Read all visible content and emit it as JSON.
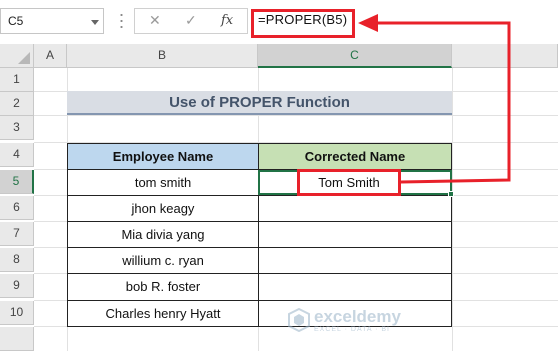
{
  "formula_bar": {
    "name_box": "C5",
    "cancel_glyph": "✕",
    "enter_glyph": "✓",
    "fx_label": "fx",
    "formula": "=PROPER(B5)"
  },
  "columns": [
    "A",
    "B",
    "C"
  ],
  "selected_column": "C",
  "rows": [
    "1",
    "2",
    "3",
    "4",
    "5",
    "6",
    "7",
    "8",
    "9",
    "10"
  ],
  "selected_row": "5",
  "title": "Use of PROPER Function",
  "table": {
    "headers": [
      "Employee Name",
      "Corrected Name"
    ],
    "rows": [
      [
        "tom smith",
        "Tom Smith"
      ],
      [
        "jhon keagy",
        ""
      ],
      [
        "Mia divia yang",
        ""
      ],
      [
        "willium c. ryan",
        ""
      ],
      [
        "bob R. foster",
        ""
      ],
      [
        "Charles henry Hyatt",
        ""
      ]
    ]
  },
  "watermark": {
    "name": "exceldemy",
    "tagline": "EXCEL · DATA · BI"
  },
  "colors": {
    "excel_green": "#217346",
    "annotation_red": "#e8212a",
    "header_blue": "#bdd7ee",
    "header_green": "#c6e0b4",
    "title_fill": "#d9dde4",
    "title_text": "#44546a"
  },
  "icons": [
    "chevron-down-icon",
    "close-icon",
    "check-icon",
    "function-icon",
    "exceldemy-logo-icon"
  ]
}
